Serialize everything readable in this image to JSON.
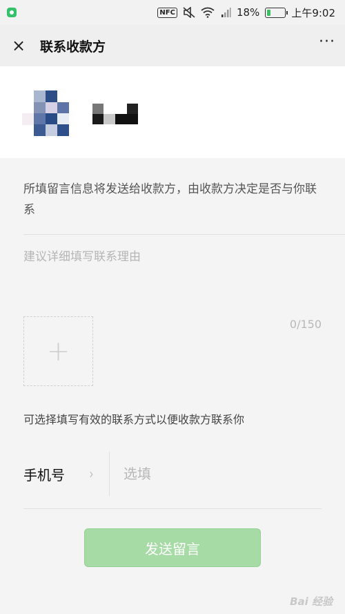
{
  "status_bar": {
    "nfc": "NFC",
    "battery_percent": "18%",
    "battery_level": 0.18,
    "time": "上午9:02",
    "icons": [
      "app-notification-icon",
      "mute-icon",
      "wifi-icon",
      "signal-icon",
      "battery-icon"
    ]
  },
  "nav": {
    "close_icon": "×",
    "title": "联系收款方",
    "more_icon": "···"
  },
  "form": {
    "notice": "所填留言信息将发送给收款方，由收款方决定是否与你联系",
    "message_placeholder": "建议详细填写联系理由",
    "counter": "0/150",
    "add_image_icon": "+",
    "contact_hint": "可选择填写有效的联系方式以便收款方联系你",
    "phone_label": "手机号",
    "phone_chevron": "›",
    "phone_placeholder": "选填",
    "submit_label": "发送留言"
  },
  "colors": {
    "accent_green": "#a6dba5",
    "background": "#f4f4f4"
  },
  "watermark": "Bai 经验"
}
